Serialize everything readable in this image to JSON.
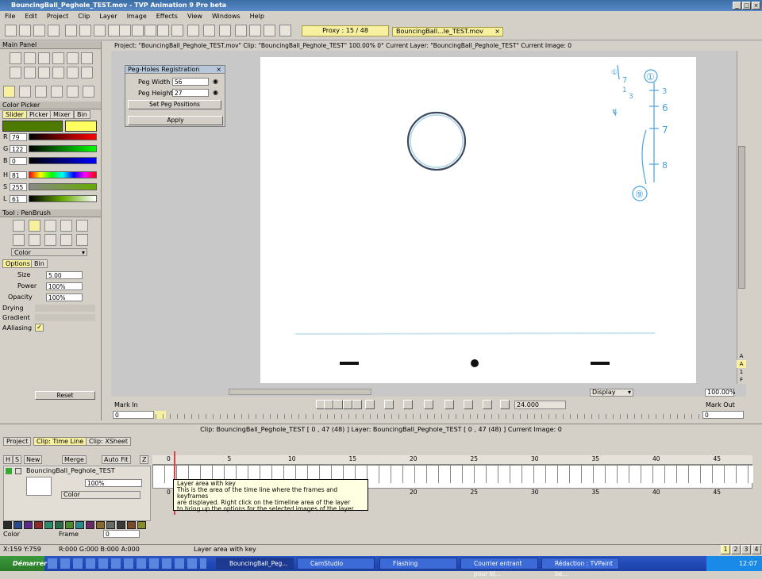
{
  "window": {
    "title": "BouncingBall_Peghole_TEST.mov - TVP Animation 9 Pro beta"
  },
  "menu": [
    "File",
    "Edit",
    "Project",
    "Clip",
    "Layer",
    "Image",
    "Effects",
    "View",
    "Windows",
    "Help"
  ],
  "toolbar": {
    "proxy": "Proxy : 15 / 48",
    "clip_name": "BouncingBall...le_TEST.mov"
  },
  "left": {
    "main_panel": "Main Panel",
    "color_picker": "Color Picker",
    "cp_tabs": [
      "Slider",
      "Picker",
      "Mixer",
      "Bin"
    ],
    "rgb": [
      {
        "label": "R",
        "value": "79"
      },
      {
        "label": "G",
        "value": "122"
      },
      {
        "label": "B",
        "value": "0"
      }
    ],
    "hsl": [
      {
        "label": "H",
        "value": "81"
      },
      {
        "label": "S",
        "value": "255"
      },
      {
        "label": "L",
        "value": "61"
      }
    ],
    "tool": "Tool : PenBrush",
    "color_mode": "Color",
    "opt_tabs": [
      "Options",
      "Bin"
    ],
    "opts": [
      {
        "label": "Size",
        "value": "5.00"
      },
      {
        "label": "Power",
        "value": "100%"
      },
      {
        "label": "Opacity",
        "value": "100%"
      }
    ],
    "drying": "Drying",
    "gradient": "Gradient",
    "aaliasing": "AAliasing",
    "reset": "Reset"
  },
  "canvas": {
    "info": "Project: \"BouncingBall_Peghole_TEST.mov\"  Clip: \"BouncingBall_Peghole_TEST\"  100.00%  0°  Current Layer: \"BouncingBall_Peghole_TEST\"  Current Image: 0"
  },
  "peg": {
    "title": "Peg-Holes Registration",
    "width_label": "Peg Width",
    "width": "56",
    "height_label": "Peg Height",
    "height": "27",
    "set": "Set Peg Positions",
    "apply": "Apply"
  },
  "transport": {
    "mark_in": "Mark In",
    "mark_out": "Mark Out",
    "fps": "24.000",
    "display": "Display",
    "zoom": "100.00%",
    "in_value": "0",
    "out_value": "0"
  },
  "timeline": {
    "header": "Clip: BouncingBall_Peghole_TEST [ 0 , 47  (48) ]    Layer: BouncingBall_Peghole_TEST [ 0 , 47  (48) ]    Current Image: 0",
    "tabs": [
      "Project",
      "Clip: Time Line",
      "Clip: XSheet"
    ],
    "cols": [
      "H",
      "S",
      "New",
      "Merge",
      "Auto Fit",
      "Z"
    ],
    "layer": "BouncingBall_Peghole_TEST",
    "opacity": "100%",
    "mode": "Color",
    "ruler": [
      "0",
      "5",
      "10",
      "15",
      "20",
      "25",
      "30",
      "35",
      "40",
      "45"
    ],
    "bottom": {
      "color": "Color",
      "frame": "Frame",
      "frame_val": "0"
    },
    "tooltip": [
      "Layer area with key",
      "This is the area of the time line where the frames and keyframes",
      "are displayed. Right click on the timeline area of the layer",
      "to bring up the options for the selected images of the layer."
    ]
  },
  "status": {
    "coords": "X:159  Y:759",
    "rgba": "R:000 G:000 B:000 A:000",
    "msg": "Layer area with key",
    "pages": [
      "1",
      "2",
      "3",
      "4"
    ]
  },
  "taskbar": {
    "start": "Démarrer",
    "tasks": [
      "BouncingBall_Peg...",
      "CamStudio",
      "Flashing",
      "Courrier entrant pour Id...",
      "Rédaction : TVPaint be..."
    ],
    "time": "12:07"
  },
  "sketch_notes": {
    "left_top": "①",
    "left_list": [
      "7",
      "1",
      "3",
      "4"
    ],
    "right_top": "①",
    "right_marks": [
      "3",
      "6",
      "7",
      "8"
    ],
    "right_bottom": "⑨",
    "small_a": "A"
  }
}
